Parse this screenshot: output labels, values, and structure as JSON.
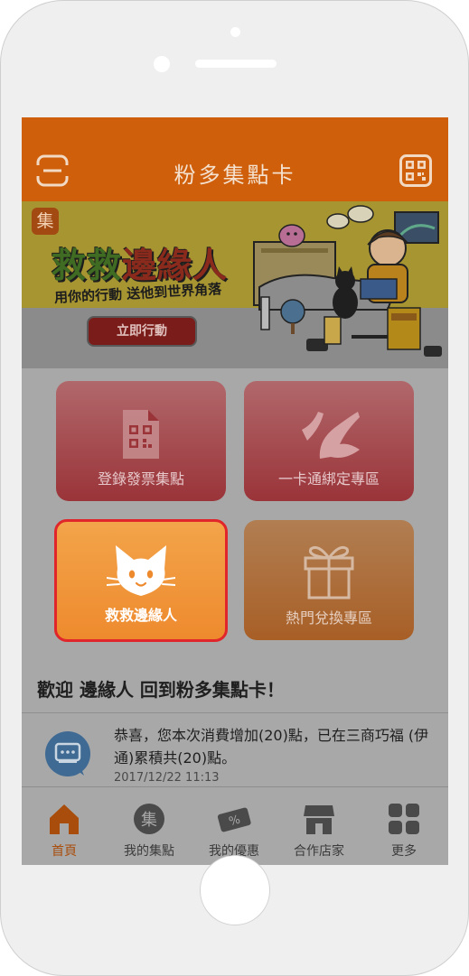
{
  "app": {
    "title": "粉多集點卡"
  },
  "banner": {
    "badge": "集",
    "headline_part1": "救救",
    "headline_part2": "邊緣人",
    "subline": "用你的行動  送他到世界角落",
    "action_label": "立即行動"
  },
  "tiles": [
    {
      "label": "登錄發票集點",
      "icon": "qr-document-icon"
    },
    {
      "label": "一卡通綁定專區",
      "icon": "ipass-logo-icon"
    },
    {
      "label": "救救邊緣人",
      "icon": "cat-icon",
      "selected": true
    },
    {
      "label": "熱門兌換專區",
      "icon": "gift-icon"
    }
  ],
  "welcome": {
    "title": "歡迎  邊緣人  回到粉多集點卡！",
    "message": "恭喜，您本次消費增加(20)點，已在三商巧福 (伊通)累積共(20)點。",
    "timestamp": "2017/12/22 11:13"
  },
  "tabbar": {
    "items": [
      {
        "label": "首頁",
        "icon": "home-icon",
        "active": true
      },
      {
        "label": "我的集點",
        "icon": "collect-points-icon"
      },
      {
        "label": "我的優惠",
        "icon": "coupon-icon"
      },
      {
        "label": "合作店家",
        "icon": "store-icon"
      },
      {
        "label": "更多",
        "icon": "grid-more-icon"
      }
    ]
  },
  "colors": {
    "header": "#cf5f0a",
    "tile_red": "#9a3439",
    "tile_orange_selected": "#ee8a2e",
    "tile_brown": "#a85f26",
    "active_tab": "#a84d0c"
  }
}
